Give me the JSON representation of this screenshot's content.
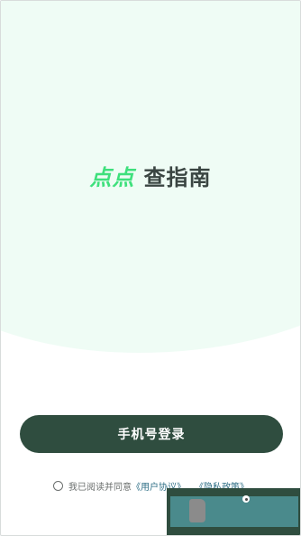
{
  "brand": {
    "accent_text": "点点",
    "main_text": "查指南",
    "accent_color": "#3ee07c"
  },
  "login": {
    "phone_login_label": "手机号登录",
    "button_color": "#2f4d3f"
  },
  "agreement": {
    "prefix": "我已阅读并同意",
    "user_agreement": "《用户协议》",
    "separator": "、",
    "privacy_policy": "《隐私政策》"
  },
  "overlay": {
    "panel_color": "#2f4d3f",
    "inner_color": "#4a8a8c"
  }
}
